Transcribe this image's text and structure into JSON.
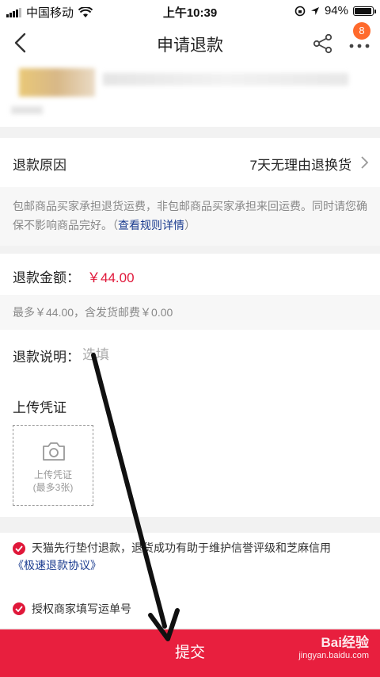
{
  "status_bar": {
    "carrier": "中国移动",
    "time": "上午10:39",
    "battery": "94%"
  },
  "nav": {
    "title": "申请退款",
    "badge_count": "8"
  },
  "refund_reason": {
    "label": "退款原因",
    "value": "7天无理由退换货"
  },
  "policy": {
    "text": "包邮商品买家承担退货运费，非包邮商品买家承担来回运费。同时请您确保不影响商品完好。（",
    "link": "查看规则详情",
    "text_end": "）"
  },
  "amount": {
    "label": "退款金额：",
    "value": "￥44.00",
    "note": "最多￥44.00，含发货邮费￥0.00"
  },
  "description": {
    "label": "退款说明：",
    "placeholder": "选填"
  },
  "upload": {
    "title": "上传凭证",
    "box_line1": "上传凭证",
    "box_line2": "(最多3张)"
  },
  "agreements": [
    {
      "text": "天猫先行垫付退款，退货成功有助于维护信誉评级和芝麻信用",
      "link": "《极速退款协议》"
    },
    {
      "text": "授权商家填写运单号"
    }
  ],
  "submit_label": "提交",
  "watermark": {
    "brand": "Bai经验",
    "url": "jingyan.baidu.com"
  },
  "colors": {
    "accent_red": "#e81f3e",
    "price_red": "#e0183a",
    "link_blue": "#1a3b8f",
    "badge_orange": "#ff6a2c"
  },
  "icons": [
    "signal-icon",
    "wifi-icon",
    "lock-rotation-icon",
    "location-icon",
    "battery-icon",
    "back-icon",
    "share-icon",
    "more-icon",
    "chevron-right-icon",
    "camera-icon",
    "check-icon"
  ]
}
